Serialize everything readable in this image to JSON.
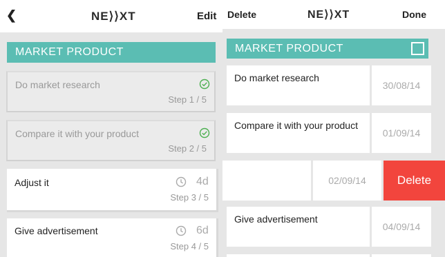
{
  "left": {
    "nav": {
      "back_glyph": "❮",
      "logo": "NE⟩⟩XT",
      "edit_label": "Edit"
    },
    "section_title": "MARKET PRODUCT",
    "tasks": [
      {
        "title": "Do market research",
        "step": "Step 1 / 5",
        "status": "done"
      },
      {
        "title": "Compare it with your product",
        "step": "Step 2 / 5",
        "status": "done"
      },
      {
        "title": "Adjust it",
        "step": "Step 3 / 5",
        "status": "pending",
        "days": "4d"
      },
      {
        "title": "Give advertisement",
        "step": "Step 4 / 5",
        "status": "pending",
        "days": "6d"
      }
    ]
  },
  "right": {
    "nav": {
      "delete_label": "Delete",
      "logo": "NE⟩⟩XT",
      "done_label": "Done"
    },
    "section_title": "MARKET PRODUCT",
    "rows": [
      {
        "title": "Do market research",
        "date": "30/08/14"
      },
      {
        "title": "Compare it with your product",
        "date": "01/09/14"
      },
      {
        "title": "",
        "date": "02/09/14",
        "delete_label": "Delete"
      },
      {
        "title": "Give advertisement",
        "date": "04/09/14"
      }
    ]
  },
  "colors": {
    "accent": "#5bbdb3",
    "check": "#4caf50",
    "delete": "#f2453d"
  }
}
